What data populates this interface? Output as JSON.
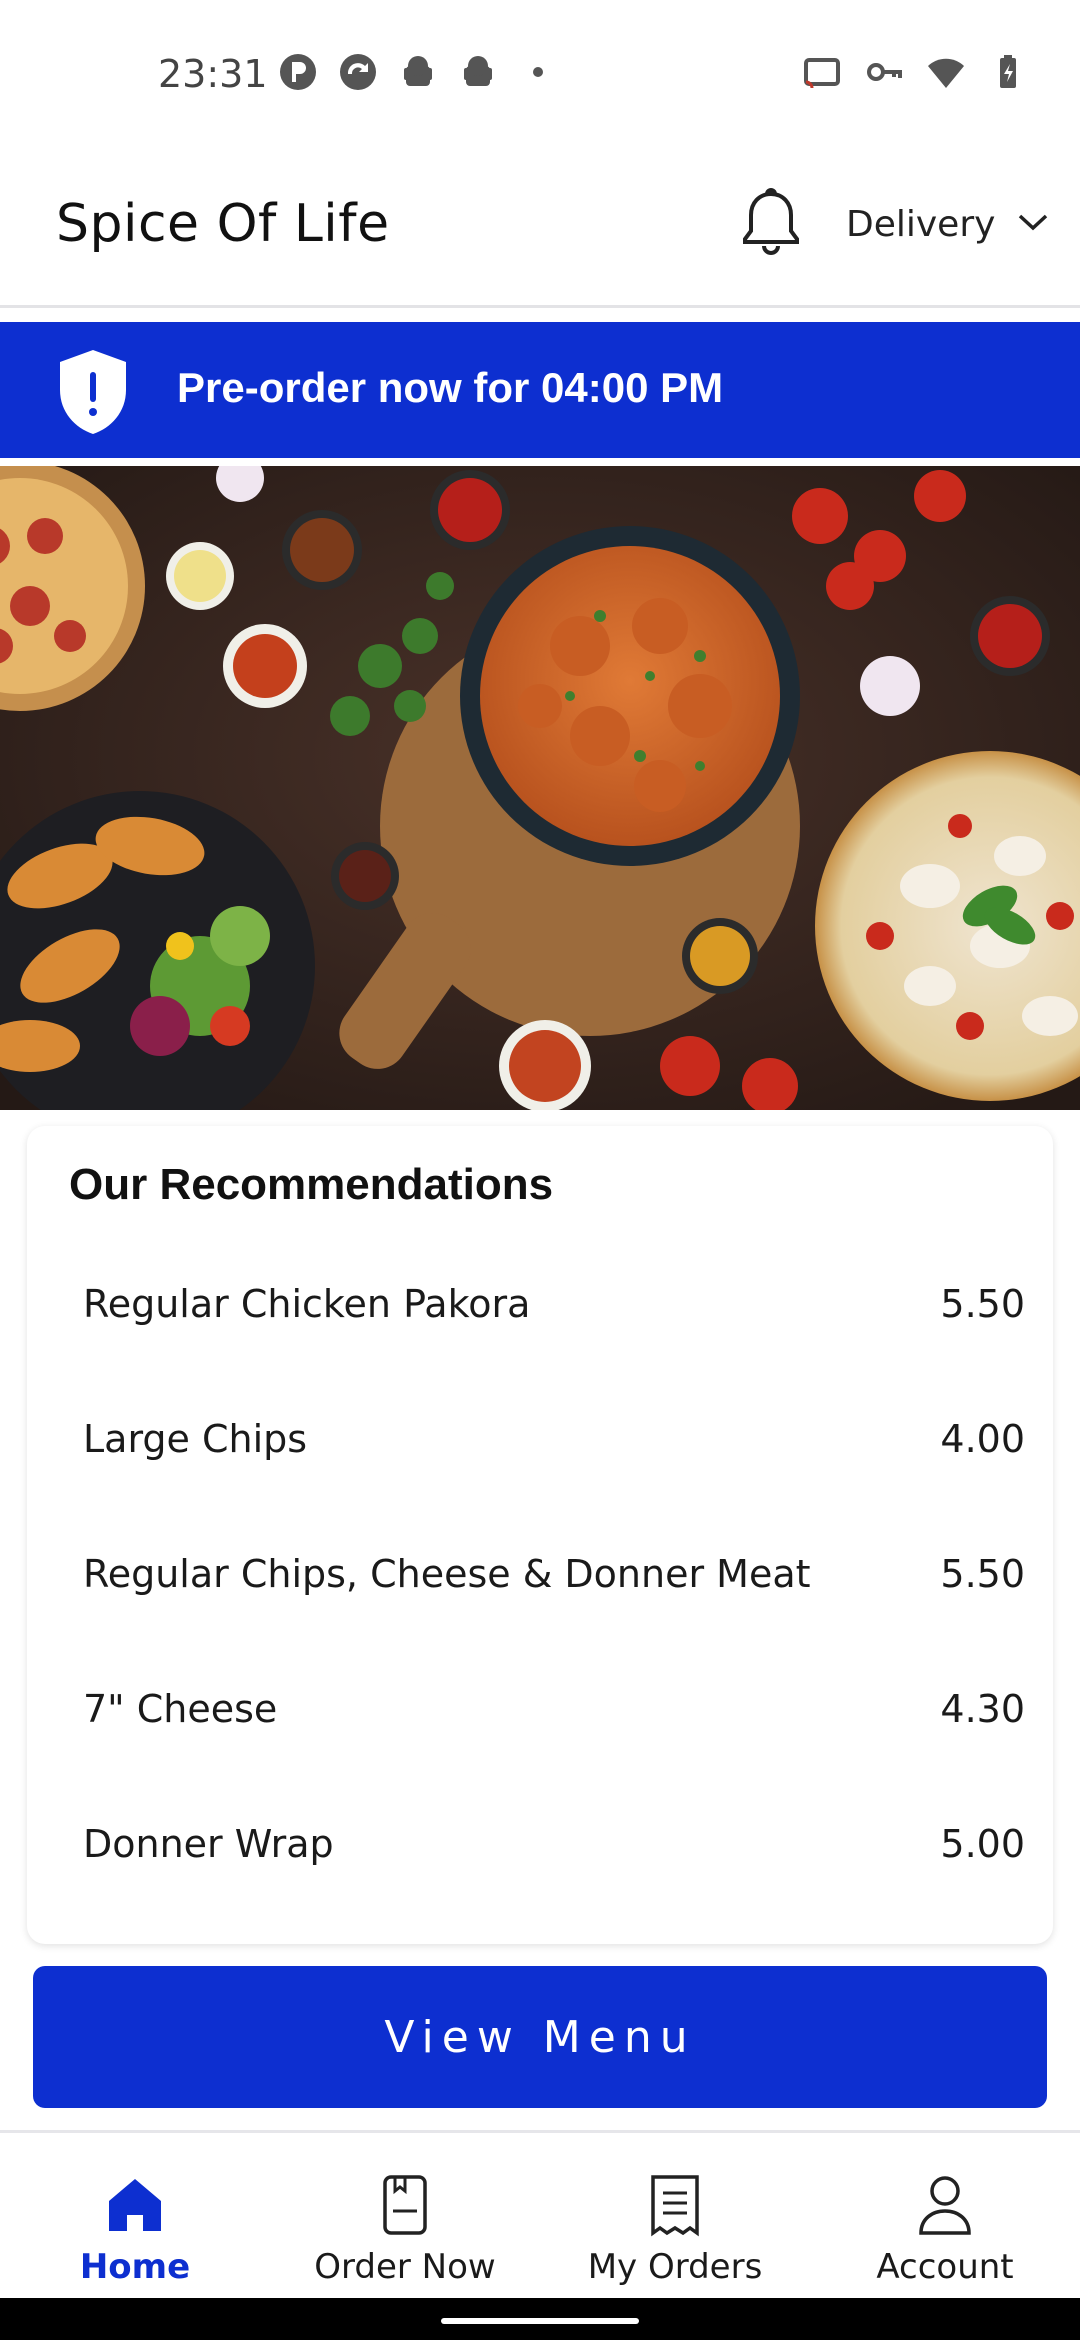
{
  "status_bar": {
    "time": "23:31",
    "left_icons": [
      "p-app-icon",
      "sync-icon",
      "android-icon",
      "android-icon",
      "dot-icon"
    ],
    "right_icons": [
      "cast-icon",
      "vpn-key-icon",
      "wifi-icon",
      "battery-charging-icon"
    ]
  },
  "app_bar": {
    "title": "Spice Of Life",
    "bell_icon": "bell-icon",
    "delivery_label": "Delivery",
    "delivery_chevron": "chevron-down-icon"
  },
  "preorder": {
    "icon": "shield-alert-icon",
    "text": "Pre-order now for 04:00 PM",
    "background": "#0d2fd0"
  },
  "recommendations": {
    "title": "Our Recommendations",
    "items": [
      {
        "name": "Regular Chicken Pakora",
        "price": "5.50"
      },
      {
        "name": "Large Chips",
        "price": "4.00"
      },
      {
        "name": "Regular Chips, Cheese & Donner Meat",
        "price": "5.50"
      },
      {
        "name": "7\" Cheese",
        "price": "4.30"
      },
      {
        "name": "Donner Wrap",
        "price": "5.00"
      }
    ]
  },
  "view_menu": {
    "label": "View Menu"
  },
  "bottom_nav": {
    "items": [
      {
        "label": "Home",
        "icon": "home-icon",
        "active": true
      },
      {
        "label": "Order Now",
        "icon": "order-book-icon",
        "active": false
      },
      {
        "label": "My Orders",
        "icon": "receipt-icon",
        "active": false
      },
      {
        "label": "Account",
        "icon": "person-icon",
        "active": false
      }
    ]
  },
  "colors": {
    "accent": "#0d2fd0",
    "text": "#111111",
    "background": "#ffffff"
  }
}
